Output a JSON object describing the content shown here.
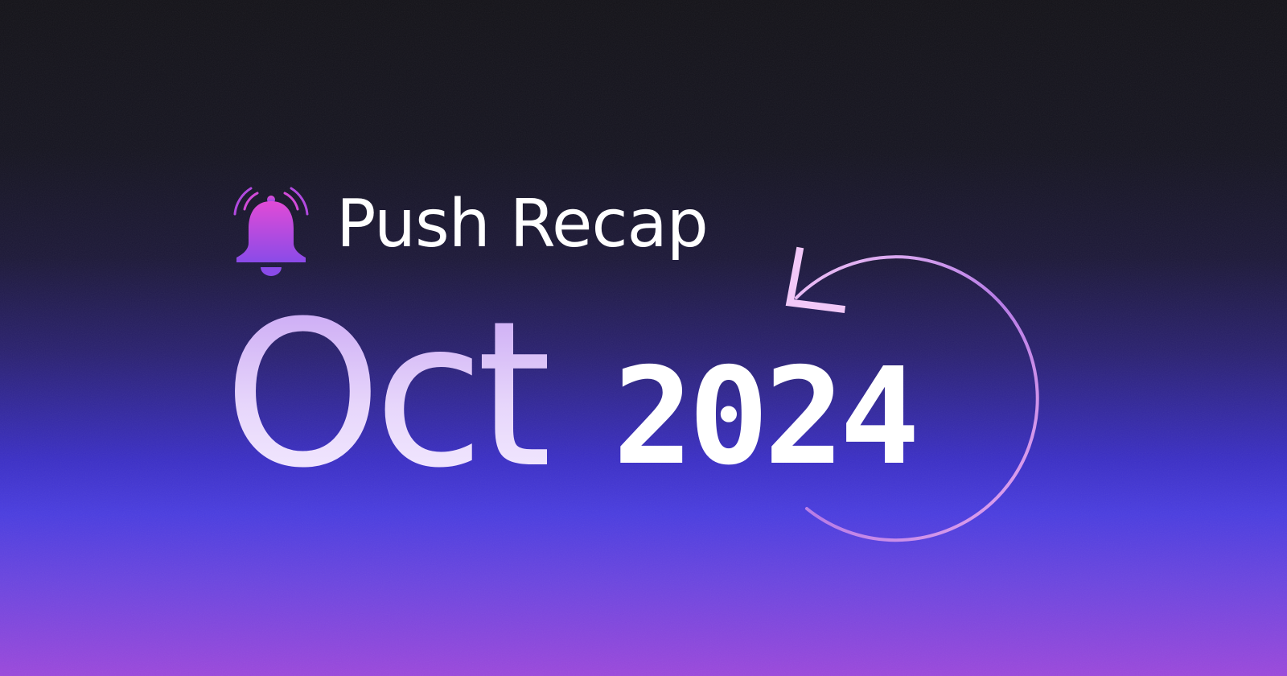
{
  "banner": {
    "headline": "Push Recap",
    "month": "Oct",
    "year": "2024",
    "icons": [
      "bell-ringing-icon",
      "refresh-arrow-icon"
    ],
    "colors": {
      "background_top": "#131218",
      "background_mid": "#3b2fc6",
      "background_bottom": "#9b48dc",
      "bell_pink": "#e14bd6",
      "bell_purple": "#8a4be8",
      "month_light": "#efe2fd",
      "text_white": "#ffffff"
    }
  }
}
